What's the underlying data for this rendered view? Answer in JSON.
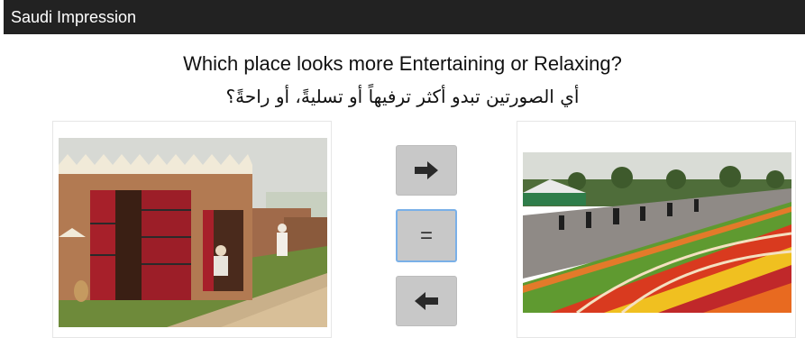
{
  "header": {
    "title": "Saudi Impression"
  },
  "question": {
    "english": "Which place looks more Entertaining or Relaxing?",
    "arabic": "أي الصورتين تبدو أكثر ترفيهاً أو تسليةً، أو راحةً؟"
  },
  "controls": {
    "right_icon": "arrow-right-icon",
    "equal_label": "=",
    "left_icon": "arrow-left-icon"
  },
  "colors": {
    "header_bg": "#222222",
    "button_bg": "#c8c8c8",
    "focus_border": "#7ab0e8"
  }
}
